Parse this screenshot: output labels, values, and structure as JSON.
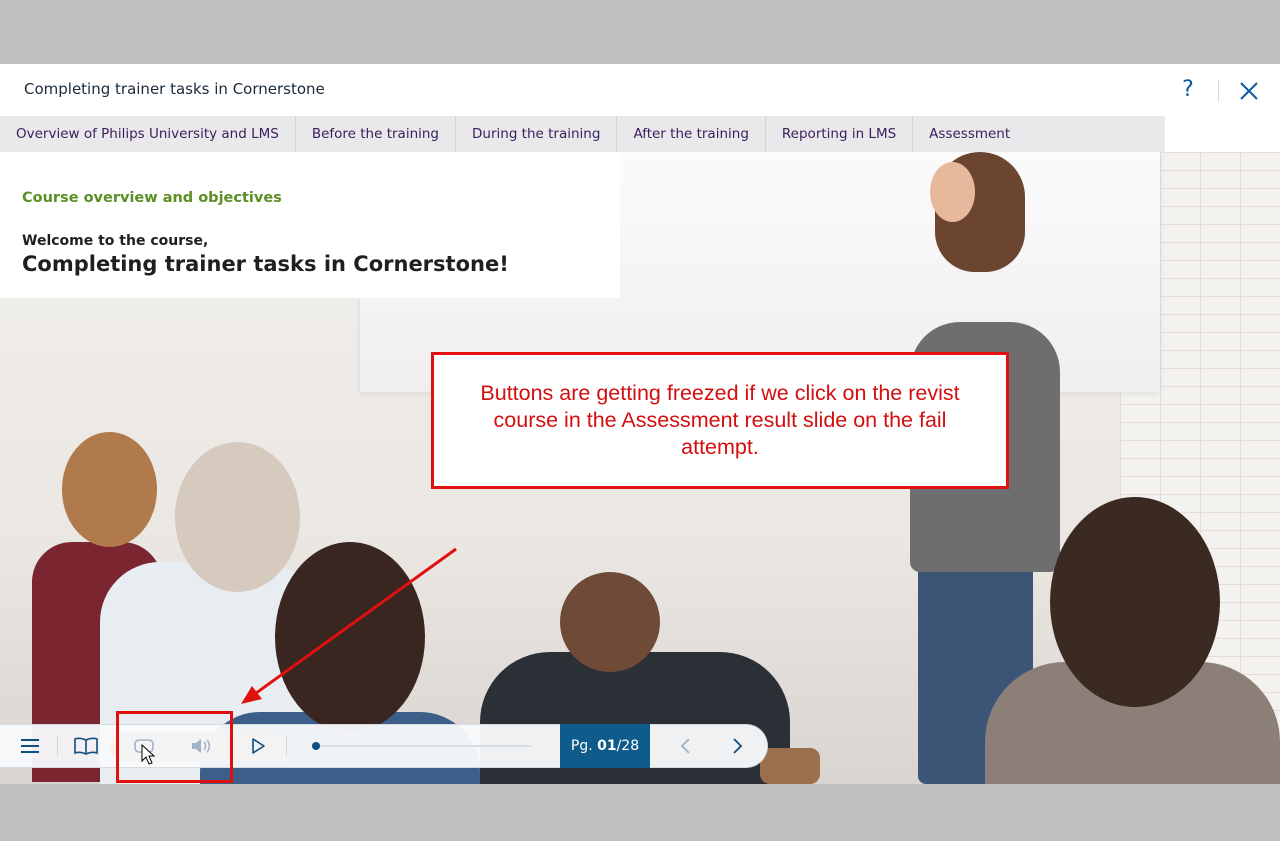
{
  "window": {
    "title": "Completing trainer tasks in Cornerstone",
    "help_label": "?"
  },
  "nav": {
    "tabs": [
      {
        "label": "Overview of Philips University and LMS"
      },
      {
        "label": "Before the training"
      },
      {
        "label": "During the training"
      },
      {
        "label": "After the training"
      },
      {
        "label": "Reporting in LMS"
      },
      {
        "label": "Assessment"
      }
    ]
  },
  "slide": {
    "overline": "Course overview and objectives",
    "welcome": "Welcome to the course,",
    "title": "Completing trainer tasks in Cornerstone!"
  },
  "annotation": {
    "text": "Buttons are getting freezed if we click on the revist course in the Assessment result slide on the fail attempt.",
    "color": "#e01010"
  },
  "player": {
    "buttons": [
      {
        "icon": "menu-icon"
      },
      {
        "icon": "book-icon"
      },
      {
        "icon": "caption-icon"
      },
      {
        "icon": "volume-icon"
      },
      {
        "icon": "play-icon"
      }
    ],
    "progress_fraction": 0.02,
    "page_prefix": "Pg.",
    "page_current": "01",
    "page_total": "/28",
    "prev_icon": "chevron-left-icon",
    "next_icon": "chevron-right-icon",
    "accent_color": "#0f5b8b"
  }
}
